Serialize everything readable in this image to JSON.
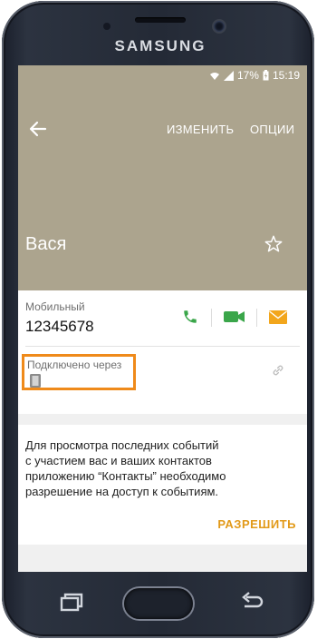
{
  "device": {
    "brand": "SAMSUNG"
  },
  "status_bar": {
    "battery": "17%",
    "time": "15:19",
    "icons": [
      "wifi-icon",
      "signal-icon",
      "battery-charging-icon"
    ]
  },
  "header": {
    "edit_label": "ИЗМЕНИТЬ",
    "options_label": "ОПЦИИ",
    "contact_name": "Вася"
  },
  "phone_section": {
    "label": "Мобильный",
    "number": "12345678"
  },
  "connected": {
    "label": "Подключено через"
  },
  "permission": {
    "lines": [
      "Для просмотра последних событий",
      "с участием вас и ваших контактов",
      "приложению “Контакты” необходимо",
      "разрешение на доступ к событиям."
    ],
    "button_label": "РАЗРЕШИТЬ"
  },
  "colors": {
    "header_bg": "#aca48e",
    "call_green": "#3aa64a",
    "email_orange": "#f2a61c",
    "accent_orange": "#e29a19",
    "highlight": "#ef8a1a"
  }
}
